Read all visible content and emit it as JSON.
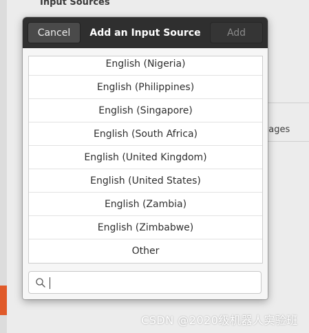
{
  "background": {
    "section_title": "Input Sources",
    "languages_partial": "uages",
    "watermark": "CSDN @2020级机器人实验班"
  },
  "dialog": {
    "title": "Add an Input Source",
    "cancel_label": "Cancel",
    "add_label": "Add",
    "items": [
      {
        "label": "English (Nigeria)"
      },
      {
        "label": "English (Philippines)"
      },
      {
        "label": "English (Singapore)"
      },
      {
        "label": "English (South Africa)"
      },
      {
        "label": "English (United Kingdom)"
      },
      {
        "label": "English (United States)"
      },
      {
        "label": "English (Zambia)"
      },
      {
        "label": "English (Zimbabwe)"
      },
      {
        "label": "Other"
      }
    ],
    "search": {
      "value": "",
      "placeholder": ""
    }
  },
  "colors": {
    "header_bg": "#2f2f2f",
    "accent_orange": "#e05a2a"
  }
}
